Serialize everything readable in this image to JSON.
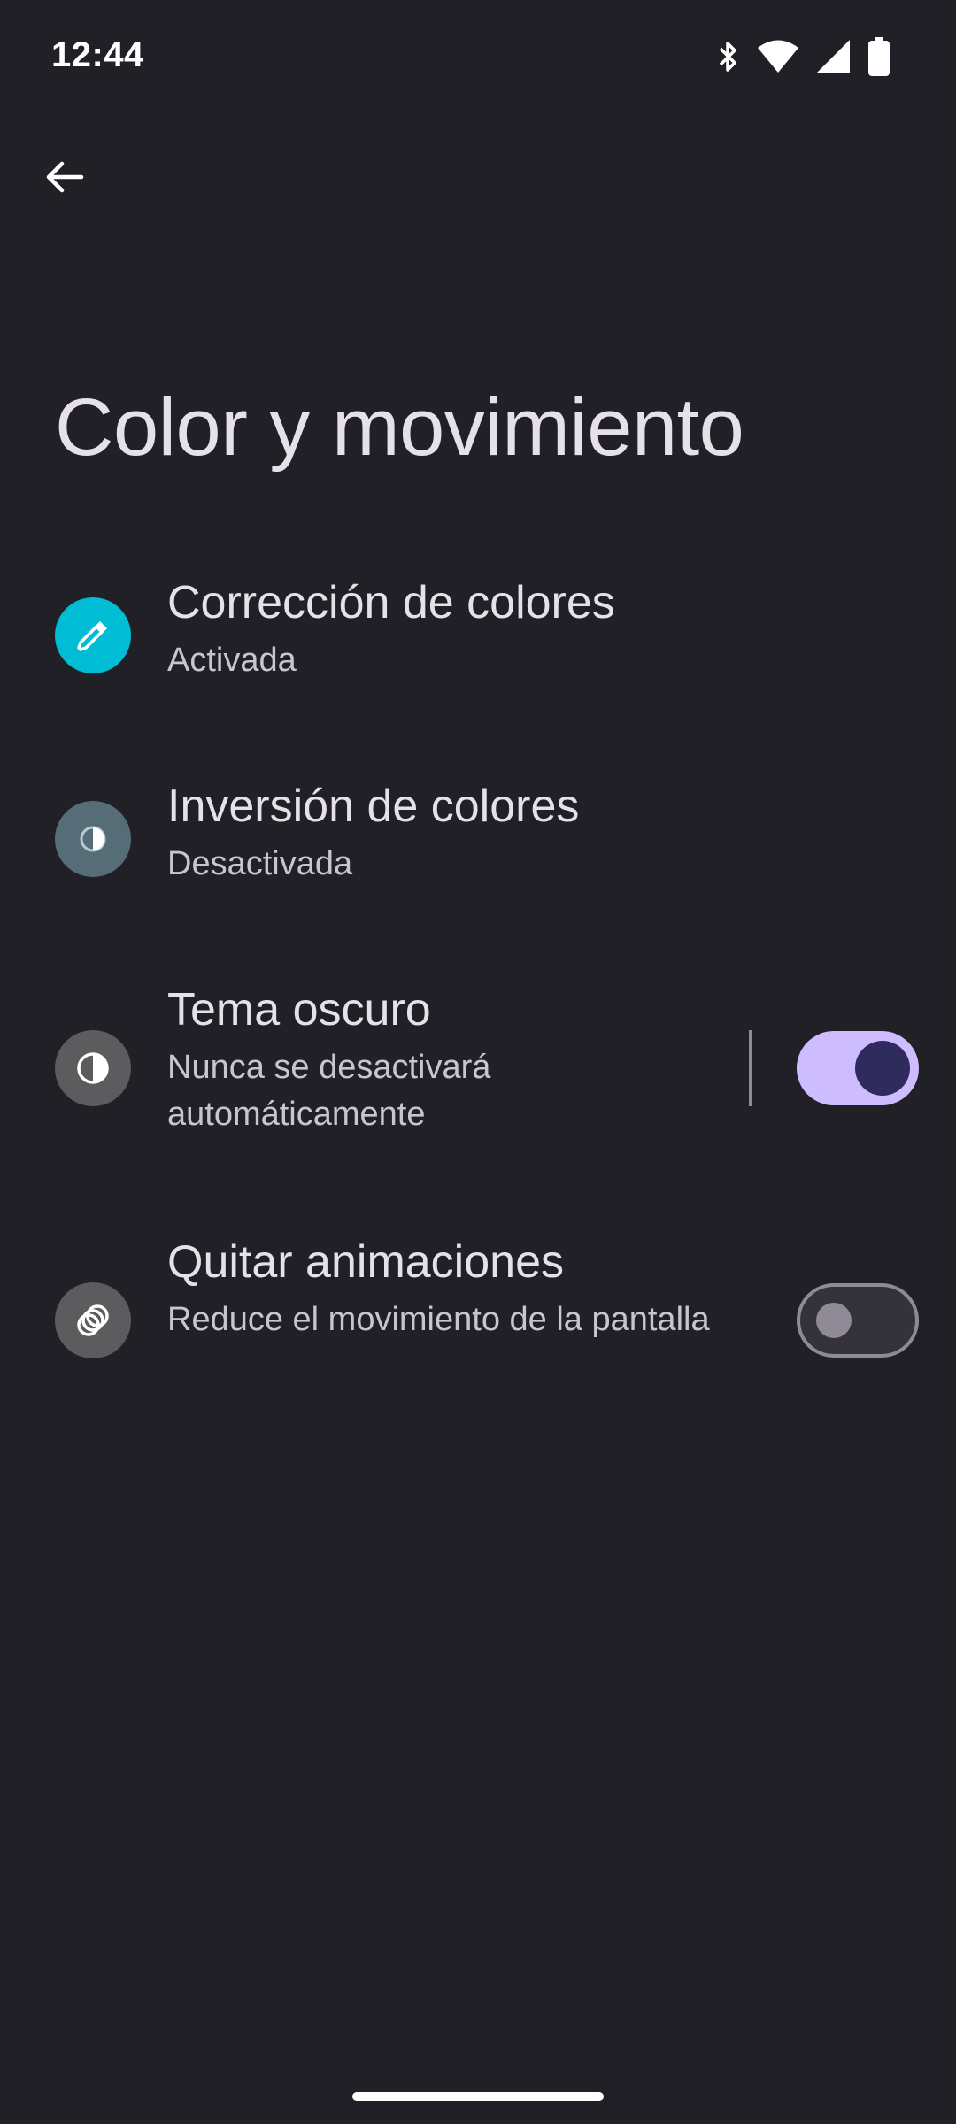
{
  "status_bar": {
    "time": "12:44",
    "icons": [
      "bluetooth-icon",
      "wifi-icon",
      "cell-signal-icon",
      "battery-icon"
    ]
  },
  "header": {
    "back_icon": "arrow-back-icon",
    "title": "Color y movimiento"
  },
  "settings": [
    {
      "title": "Corrección de colores",
      "summary": "Activada",
      "icon": "eyedropper-icon",
      "icon_bg": "#00bcd4"
    },
    {
      "title": "Inversión de colores",
      "summary": "Desactivada",
      "icon": "color-inversion-icon",
      "icon_bg": "#566c77"
    },
    {
      "title": "Tema oscuro",
      "summary": "Nunca se desactivará automáticamente",
      "icon": "dark-theme-icon",
      "icon_bg": "#5c5c5e",
      "toggle": "on"
    },
    {
      "title": "Quitar animaciones",
      "summary": "Reduce el movimiento de la pantalla",
      "icon": "animations-icon",
      "icon_bg": "#5c5c5e",
      "toggle": "off"
    }
  ],
  "colors": {
    "background": "#202026",
    "switch_on_track": "#cdbdff",
    "switch_on_thumb": "#2f2b5c",
    "switch_off_outline": "#8f8a95"
  }
}
